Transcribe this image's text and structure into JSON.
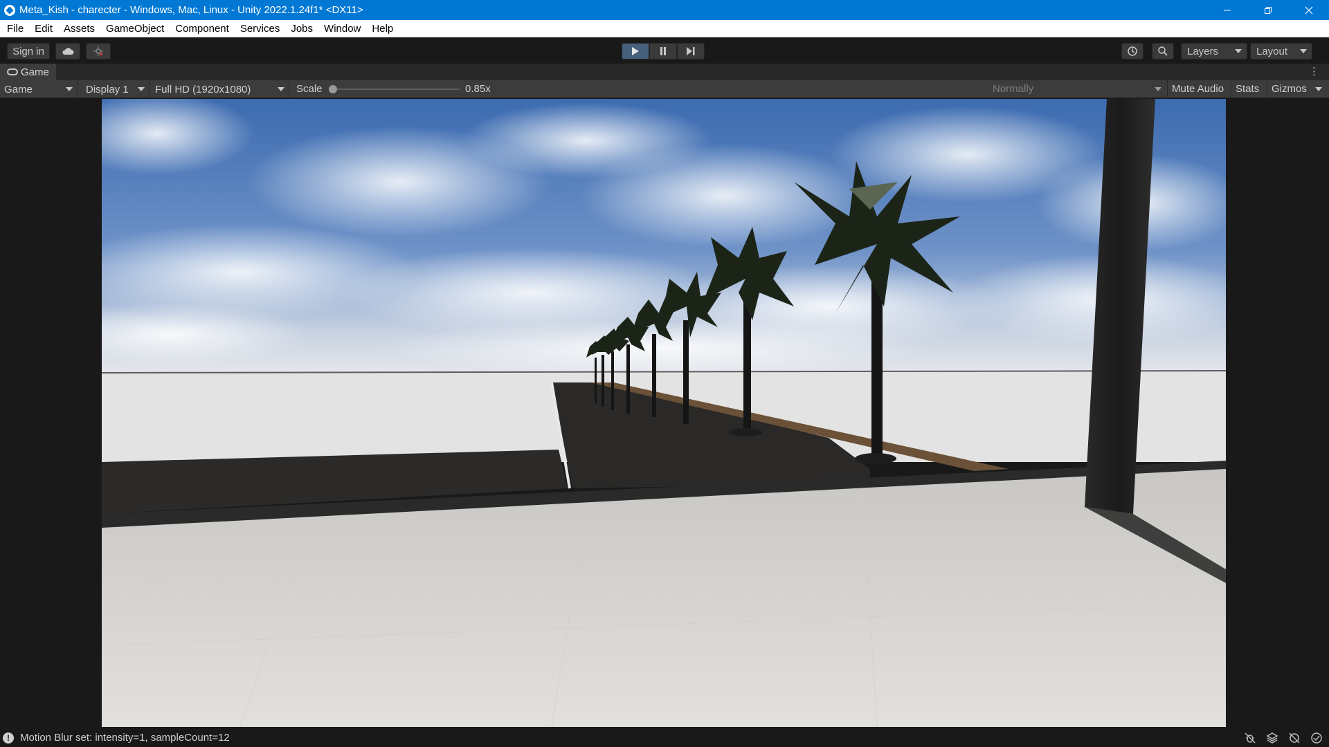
{
  "window": {
    "title": "Meta_Kish - charecter - Windows, Mac, Linux - Unity 2022.1.24f1* <DX11>",
    "controls": [
      "minimize-icon",
      "restore-icon",
      "close-icon"
    ]
  },
  "menu": {
    "items": [
      "File",
      "Edit",
      "Assets",
      "GameObject",
      "Component",
      "Services",
      "Jobs",
      "Window",
      "Help"
    ]
  },
  "toolbar": {
    "sign_in_label": "Sign in",
    "cloud_icon": "cloud-icon",
    "collab_icon": "collab-icon",
    "play_mode": "playing",
    "layers_label": "Layers",
    "layout_label": "Layout"
  },
  "tab": {
    "label": "Game",
    "icon": "gamepad-icon"
  },
  "game_toolbar": {
    "view_select": "Game",
    "display_select": "Display 1",
    "resolution_select": "Full HD (1920x1080)",
    "scale_label": "Scale",
    "scale_value": "0.85x",
    "scale_fraction": 0.0,
    "play_focus_select": "Normally",
    "mute_audio_label": "Mute Audio",
    "stats_label": "Stats",
    "gizmos_label": "Gizmos"
  },
  "status": {
    "message": "Motion Blur set: intensity=1, sampleCount=12",
    "icons": [
      "bug-icon",
      "layers-stack-icon",
      "progress-icon",
      "check-icon"
    ]
  },
  "colors": {
    "titlebar": "#0078d4",
    "play_active": "#46607c",
    "sky_top": "#3c6bb0",
    "ground": "#dcdcdc"
  }
}
